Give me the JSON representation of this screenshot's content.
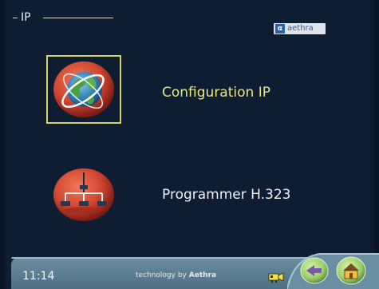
{
  "screen": {
    "title": "IP",
    "brand": {
      "mark": "α",
      "name": "aethra"
    }
  },
  "menu": {
    "items": [
      {
        "label": "Configuration IP",
        "icon": "globe-icon",
        "selected": true
      },
      {
        "label": "Programmer H.323",
        "icon": "network-icon",
        "selected": false
      }
    ]
  },
  "status_bar": {
    "time": "11:14",
    "technology_prefix": "technology by",
    "technology_brand": "Aethra",
    "buttons": [
      {
        "name": "back",
        "icon": "back-arrow-icon"
      },
      {
        "name": "home",
        "icon": "home-icon"
      }
    ]
  },
  "colors": {
    "background": "#0f1d33",
    "selection": "#d2d463",
    "selected_text": "#e6e882",
    "bar": "#5c7d91",
    "accent_green": "#9ccf6a"
  }
}
